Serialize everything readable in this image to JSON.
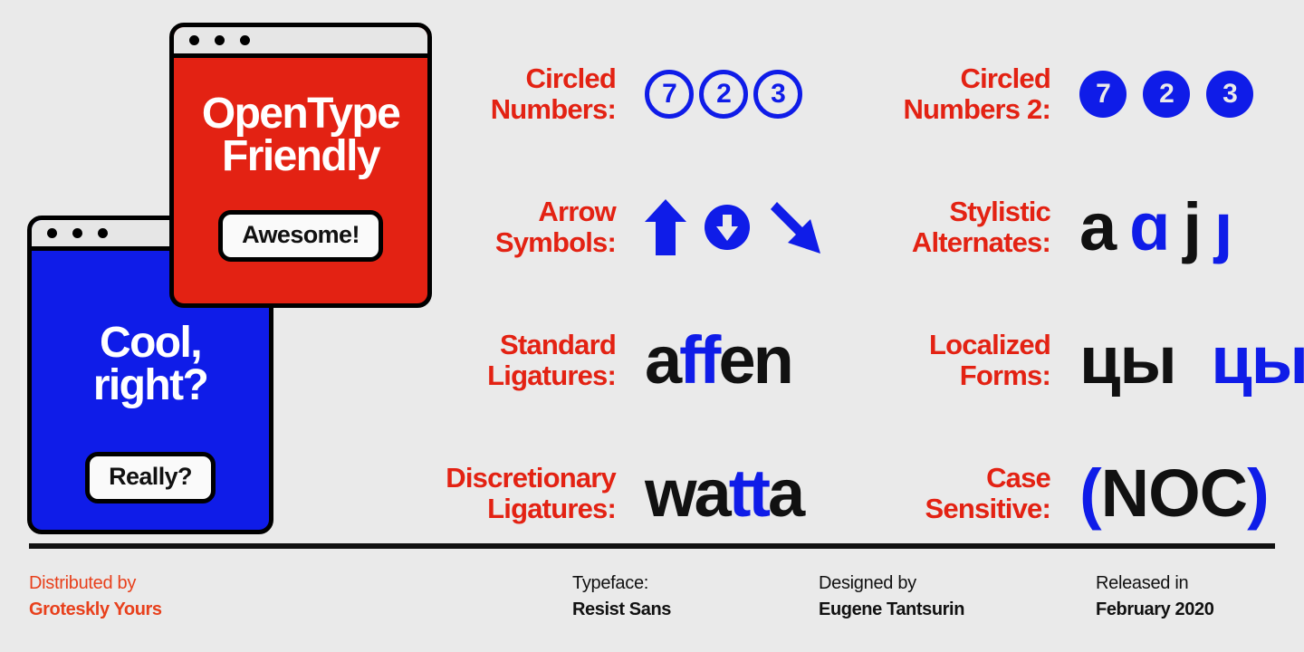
{
  "meta": {
    "poster_type": "type-specimen",
    "background_color": "#eaeaea",
    "red": "#e32213",
    "blue": "#0f1ce8",
    "black": "#111111"
  },
  "windows": [
    {
      "id": "red-window",
      "heading": "OpenType\nFriendly",
      "button_label": "Awesome!",
      "bg": "#e32213"
    },
    {
      "id": "blue-window",
      "heading": "Cool,\nright?",
      "button_label": "Really?",
      "bg": "#0f1ce8"
    }
  ],
  "features": [
    {
      "label": "Circled\nNumbers:",
      "style": "circled-outline",
      "values": [
        "7",
        "2",
        "3"
      ]
    },
    {
      "label": "Circled\nNumbers 2:",
      "style": "circled-filled",
      "values": [
        "7",
        "2",
        "3"
      ]
    },
    {
      "label": "Arrow\nSymbols:",
      "style": "arrows",
      "values": [
        "arrow-up",
        "arrow-down-circled",
        "arrow-down-right"
      ]
    },
    {
      "label": "Stylistic\nAlternates:",
      "style": "glyphs",
      "sample_plain_1": "a",
      "sample_hl_1": "ɑ",
      "sample_plain_2": "j",
      "sample_hl_2": "ȷ"
    },
    {
      "label": "Standard\nLigatures:",
      "style": "glyphs",
      "sample_plain_1": "a",
      "sample_hl_1": "ff",
      "sample_plain_2": "en",
      "sample_hl_2": ""
    },
    {
      "label": "Localized\nForms:",
      "style": "glyphs",
      "sample_plain_1": "цы",
      "sample_hl_1": "цы",
      "sample_plain_2": "",
      "sample_hl_2": ""
    },
    {
      "label": "Discretionary\nLigatures:",
      "style": "glyphs",
      "sample_plain_1": "wa",
      "sample_hl_1": "tt",
      "sample_plain_2": "a",
      "sample_hl_2": ""
    },
    {
      "label": "Case\nSensitive:",
      "style": "glyphs",
      "sample_plain_1": "",
      "sample_hl_1": "(",
      "sample_plain_2": "NOC",
      "sample_hl_2": ")"
    }
  ],
  "footer": {
    "columns": [
      {
        "top": "Distributed by",
        "bottom": "Groteskly Yours",
        "accent": "#e8401c"
      },
      {
        "top": "Typeface:",
        "bottom": "Resist Sans",
        "accent": "#111111"
      },
      {
        "top": "Designed by",
        "bottom": "Eugene Tantsurin",
        "accent": "#111111"
      },
      {
        "top": "Released in",
        "bottom": "February 2020",
        "accent": "#111111"
      }
    ]
  }
}
